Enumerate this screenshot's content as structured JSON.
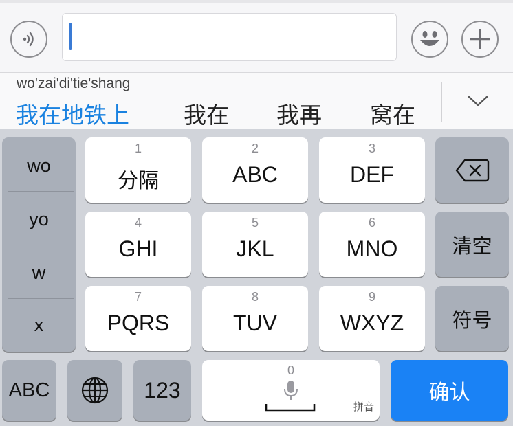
{
  "input": {
    "value": ""
  },
  "candidates": {
    "pinyin": "wo'zai'di'tie'shang",
    "items": [
      "我在地铁上",
      "我在",
      "我再",
      "窝在"
    ]
  },
  "side_column": {
    "items": [
      "wo",
      "yo",
      "w",
      "x"
    ]
  },
  "keys": [
    {
      "num": "1",
      "label": "分隔"
    },
    {
      "num": "2",
      "label": "ABC"
    },
    {
      "num": "3",
      "label": "DEF"
    },
    {
      "num": "4",
      "label": "GHI"
    },
    {
      "num": "5",
      "label": "JKL"
    },
    {
      "num": "6",
      "label": "MNO"
    },
    {
      "num": "7",
      "label": "PQRS"
    },
    {
      "num": "8",
      "label": "TUV"
    },
    {
      "num": "9",
      "label": "WXYZ"
    }
  ],
  "right_column": {
    "clear": "清空",
    "symbols": "符号"
  },
  "bottom_row": {
    "abc": "ABC",
    "numbers": "123",
    "space_num": "0",
    "space_label": "拼音",
    "confirm": "确认"
  },
  "icons": {
    "voice": "voice-input-icon",
    "emoji": "emoji-icon",
    "add": "plus-icon",
    "expand": "chevron-down-icon",
    "backspace": "backspace-icon",
    "globe": "globe-icon",
    "microphone": "microphone-icon"
  },
  "colors": {
    "accent": "#1a82f5",
    "candidate_highlight": "#1a82e0",
    "keyboard_bg": "#d1d4da",
    "function_key": "#a9afb9"
  }
}
